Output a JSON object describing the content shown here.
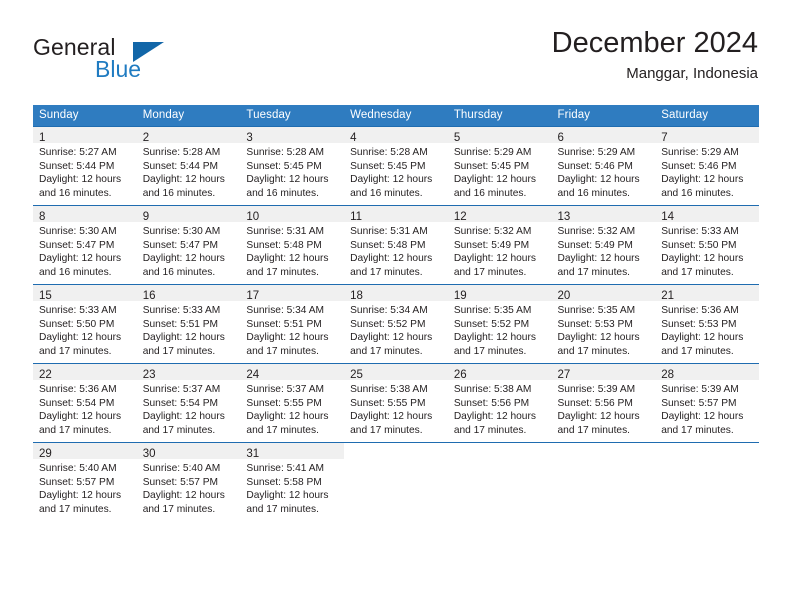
{
  "brand": {
    "name_part1": "General",
    "name_part2": "Blue",
    "logo_icon": "triangle-logo-icon"
  },
  "header": {
    "title": "December 2024",
    "subtitle": "Manggar, Indonesia"
  },
  "calendar": {
    "weekday_headers": [
      "Sunday",
      "Monday",
      "Tuesday",
      "Wednesday",
      "Thursday",
      "Friday",
      "Saturday"
    ],
    "accent_color": "#2f7cc0",
    "row_border_color": "#1f6cb0",
    "daynum_band_color": "#f0f0f0",
    "weeks": [
      [
        {
          "day": "1",
          "sunrise": "Sunrise: 5:27 AM",
          "sunset": "Sunset: 5:44 PM",
          "daylight_line1": "Daylight: 12 hours",
          "daylight_line2": "and 16 minutes."
        },
        {
          "day": "2",
          "sunrise": "Sunrise: 5:28 AM",
          "sunset": "Sunset: 5:44 PM",
          "daylight_line1": "Daylight: 12 hours",
          "daylight_line2": "and 16 minutes."
        },
        {
          "day": "3",
          "sunrise": "Sunrise: 5:28 AM",
          "sunset": "Sunset: 5:45 PM",
          "daylight_line1": "Daylight: 12 hours",
          "daylight_line2": "and 16 minutes."
        },
        {
          "day": "4",
          "sunrise": "Sunrise: 5:28 AM",
          "sunset": "Sunset: 5:45 PM",
          "daylight_line1": "Daylight: 12 hours",
          "daylight_line2": "and 16 minutes."
        },
        {
          "day": "5",
          "sunrise": "Sunrise: 5:29 AM",
          "sunset": "Sunset: 5:45 PM",
          "daylight_line1": "Daylight: 12 hours",
          "daylight_line2": "and 16 minutes."
        },
        {
          "day": "6",
          "sunrise": "Sunrise: 5:29 AM",
          "sunset": "Sunset: 5:46 PM",
          "daylight_line1": "Daylight: 12 hours",
          "daylight_line2": "and 16 minutes."
        },
        {
          "day": "7",
          "sunrise": "Sunrise: 5:29 AM",
          "sunset": "Sunset: 5:46 PM",
          "daylight_line1": "Daylight: 12 hours",
          "daylight_line2": "and 16 minutes."
        }
      ],
      [
        {
          "day": "8",
          "sunrise": "Sunrise: 5:30 AM",
          "sunset": "Sunset: 5:47 PM",
          "daylight_line1": "Daylight: 12 hours",
          "daylight_line2": "and 16 minutes."
        },
        {
          "day": "9",
          "sunrise": "Sunrise: 5:30 AM",
          "sunset": "Sunset: 5:47 PM",
          "daylight_line1": "Daylight: 12 hours",
          "daylight_line2": "and 16 minutes."
        },
        {
          "day": "10",
          "sunrise": "Sunrise: 5:31 AM",
          "sunset": "Sunset: 5:48 PM",
          "daylight_line1": "Daylight: 12 hours",
          "daylight_line2": "and 17 minutes."
        },
        {
          "day": "11",
          "sunrise": "Sunrise: 5:31 AM",
          "sunset": "Sunset: 5:48 PM",
          "daylight_line1": "Daylight: 12 hours",
          "daylight_line2": "and 17 minutes."
        },
        {
          "day": "12",
          "sunrise": "Sunrise: 5:32 AM",
          "sunset": "Sunset: 5:49 PM",
          "daylight_line1": "Daylight: 12 hours",
          "daylight_line2": "and 17 minutes."
        },
        {
          "day": "13",
          "sunrise": "Sunrise: 5:32 AM",
          "sunset": "Sunset: 5:49 PM",
          "daylight_line1": "Daylight: 12 hours",
          "daylight_line2": "and 17 minutes."
        },
        {
          "day": "14",
          "sunrise": "Sunrise: 5:33 AM",
          "sunset": "Sunset: 5:50 PM",
          "daylight_line1": "Daylight: 12 hours",
          "daylight_line2": "and 17 minutes."
        }
      ],
      [
        {
          "day": "15",
          "sunrise": "Sunrise: 5:33 AM",
          "sunset": "Sunset: 5:50 PM",
          "daylight_line1": "Daylight: 12 hours",
          "daylight_line2": "and 17 minutes."
        },
        {
          "day": "16",
          "sunrise": "Sunrise: 5:33 AM",
          "sunset": "Sunset: 5:51 PM",
          "daylight_line1": "Daylight: 12 hours",
          "daylight_line2": "and 17 minutes."
        },
        {
          "day": "17",
          "sunrise": "Sunrise: 5:34 AM",
          "sunset": "Sunset: 5:51 PM",
          "daylight_line1": "Daylight: 12 hours",
          "daylight_line2": "and 17 minutes."
        },
        {
          "day": "18",
          "sunrise": "Sunrise: 5:34 AM",
          "sunset": "Sunset: 5:52 PM",
          "daylight_line1": "Daylight: 12 hours",
          "daylight_line2": "and 17 minutes."
        },
        {
          "day": "19",
          "sunrise": "Sunrise: 5:35 AM",
          "sunset": "Sunset: 5:52 PM",
          "daylight_line1": "Daylight: 12 hours",
          "daylight_line2": "and 17 minutes."
        },
        {
          "day": "20",
          "sunrise": "Sunrise: 5:35 AM",
          "sunset": "Sunset: 5:53 PM",
          "daylight_line1": "Daylight: 12 hours",
          "daylight_line2": "and 17 minutes."
        },
        {
          "day": "21",
          "sunrise": "Sunrise: 5:36 AM",
          "sunset": "Sunset: 5:53 PM",
          "daylight_line1": "Daylight: 12 hours",
          "daylight_line2": "and 17 minutes."
        }
      ],
      [
        {
          "day": "22",
          "sunrise": "Sunrise: 5:36 AM",
          "sunset": "Sunset: 5:54 PM",
          "daylight_line1": "Daylight: 12 hours",
          "daylight_line2": "and 17 minutes."
        },
        {
          "day": "23",
          "sunrise": "Sunrise: 5:37 AM",
          "sunset": "Sunset: 5:54 PM",
          "daylight_line1": "Daylight: 12 hours",
          "daylight_line2": "and 17 minutes."
        },
        {
          "day": "24",
          "sunrise": "Sunrise: 5:37 AM",
          "sunset": "Sunset: 5:55 PM",
          "daylight_line1": "Daylight: 12 hours",
          "daylight_line2": "and 17 minutes."
        },
        {
          "day": "25",
          "sunrise": "Sunrise: 5:38 AM",
          "sunset": "Sunset: 5:55 PM",
          "daylight_line1": "Daylight: 12 hours",
          "daylight_line2": "and 17 minutes."
        },
        {
          "day": "26",
          "sunrise": "Sunrise: 5:38 AM",
          "sunset": "Sunset: 5:56 PM",
          "daylight_line1": "Daylight: 12 hours",
          "daylight_line2": "and 17 minutes."
        },
        {
          "day": "27",
          "sunrise": "Sunrise: 5:39 AM",
          "sunset": "Sunset: 5:56 PM",
          "daylight_line1": "Daylight: 12 hours",
          "daylight_line2": "and 17 minutes."
        },
        {
          "day": "28",
          "sunrise": "Sunrise: 5:39 AM",
          "sunset": "Sunset: 5:57 PM",
          "daylight_line1": "Daylight: 12 hours",
          "daylight_line2": "and 17 minutes."
        }
      ],
      [
        {
          "day": "29",
          "sunrise": "Sunrise: 5:40 AM",
          "sunset": "Sunset: 5:57 PM",
          "daylight_line1": "Daylight: 12 hours",
          "daylight_line2": "and 17 minutes."
        },
        {
          "day": "30",
          "sunrise": "Sunrise: 5:40 AM",
          "sunset": "Sunset: 5:57 PM",
          "daylight_line1": "Daylight: 12 hours",
          "daylight_line2": "and 17 minutes."
        },
        {
          "day": "31",
          "sunrise": "Sunrise: 5:41 AM",
          "sunset": "Sunset: 5:58 PM",
          "daylight_line1": "Daylight: 12 hours",
          "daylight_line2": "and 17 minutes."
        },
        {
          "day": "",
          "sunrise": "",
          "sunset": "",
          "daylight_line1": "",
          "daylight_line2": ""
        },
        {
          "day": "",
          "sunrise": "",
          "sunset": "",
          "daylight_line1": "",
          "daylight_line2": ""
        },
        {
          "day": "",
          "sunrise": "",
          "sunset": "",
          "daylight_line1": "",
          "daylight_line2": ""
        },
        {
          "day": "",
          "sunrise": "",
          "sunset": "",
          "daylight_line1": "",
          "daylight_line2": ""
        }
      ]
    ]
  }
}
